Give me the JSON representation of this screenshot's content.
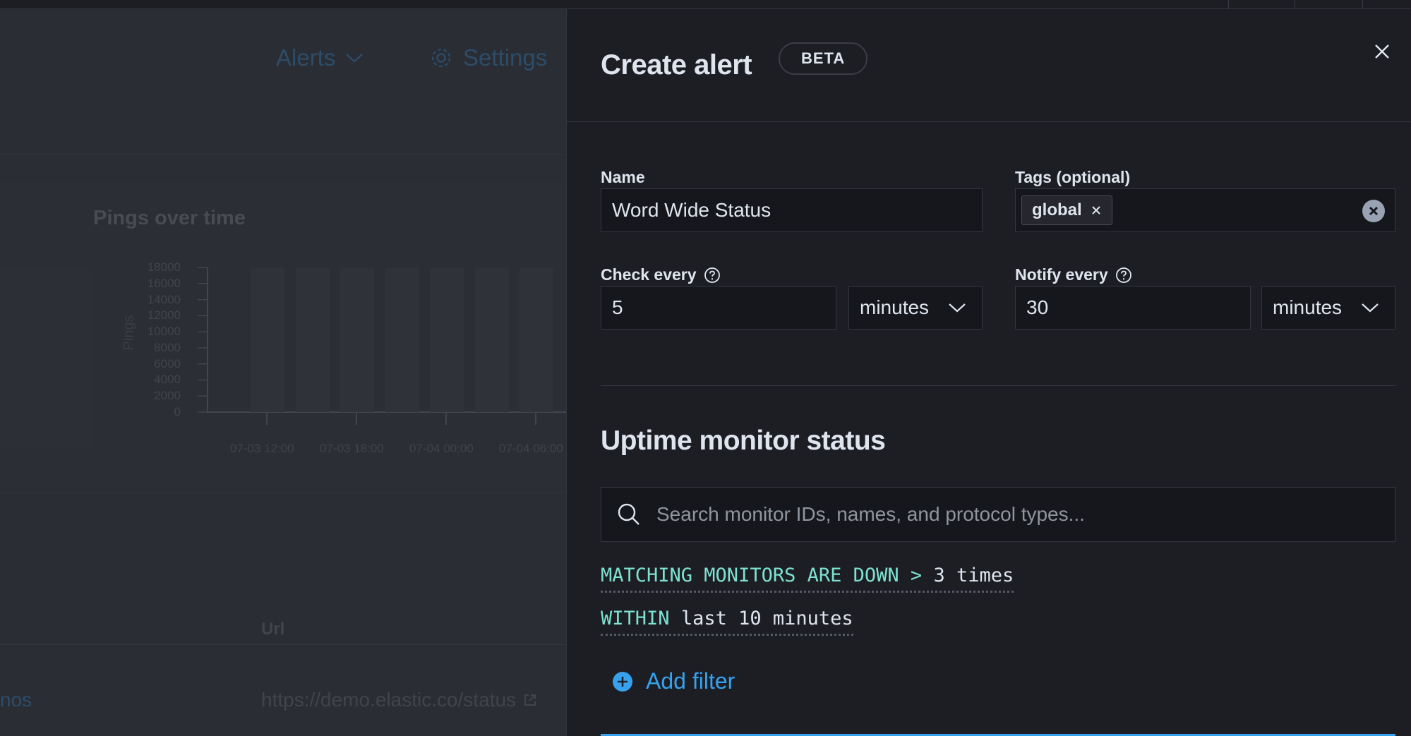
{
  "background_app": {
    "nav": {
      "alerts_label": "Alerts",
      "settings_label": "Settings"
    },
    "chart_title": "Pings over time",
    "url_header": "Url",
    "row_name_fragment": "nos",
    "row_url": "https://demo.elastic.co/status"
  },
  "chart_data": {
    "type": "bar",
    "title": "Pings over time",
    "ylabel": "Pings",
    "yticks": [
      "18000",
      "16000",
      "14000",
      "12000",
      "10000",
      "8000",
      "6000",
      "4000",
      "2000",
      "0"
    ],
    "ylim": [
      0,
      18000
    ],
    "xticks": [
      "07-03 12:00",
      "07-03 18:00",
      "07-04 00:00",
      "07-04 06:00"
    ],
    "values": [
      18000,
      18000,
      18000,
      18000,
      18000,
      18000,
      18000
    ]
  },
  "flyout": {
    "title": "Create alert",
    "badge": "BETA",
    "name": {
      "label": "Name",
      "value": "Word Wide Status"
    },
    "tags": {
      "label": "Tags (optional)",
      "items": [
        "global"
      ]
    },
    "check_every": {
      "label": "Check every",
      "value": "5",
      "unit": "minutes"
    },
    "notify_every": {
      "label": "Notify every",
      "value": "30",
      "unit": "minutes"
    },
    "section_title": "Uptime monitor status",
    "search": {
      "placeholder": "Search monitor IDs, names, and protocol types..."
    },
    "expression_1": {
      "keyword": "MATCHING MONITORS ARE DOWN",
      "operator": ">",
      "value": "3 times"
    },
    "expression_2": {
      "keyword": "WITHIN",
      "value": "last 10 minutes"
    },
    "add_filter_label": "Add filter"
  },
  "colors": {
    "accent": "#36a2ef",
    "keyword": "#7de2d1",
    "panel_bg": "#1d1e24"
  }
}
